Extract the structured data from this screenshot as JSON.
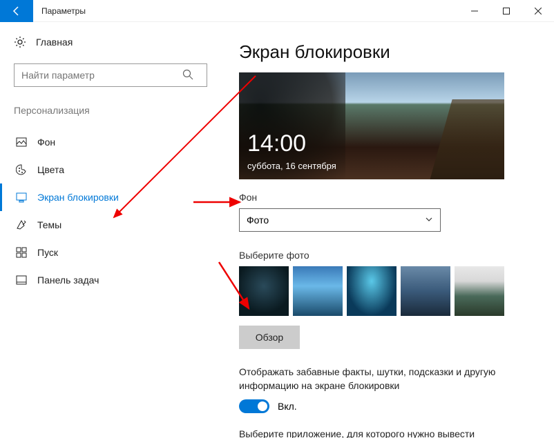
{
  "window": {
    "title": "Параметры"
  },
  "sidebar": {
    "home": "Главная",
    "search_placeholder": "Найти параметр",
    "category": "Персонализация",
    "items": [
      {
        "label": "Фон"
      },
      {
        "label": "Цвета"
      },
      {
        "label": "Экран блокировки"
      },
      {
        "label": "Темы"
      },
      {
        "label": "Пуск"
      },
      {
        "label": "Панель задач"
      }
    ]
  },
  "main": {
    "title": "Экран блокировки",
    "preview": {
      "time": "14:00",
      "date": "суббота, 16 сентября"
    },
    "background_label": "Фон",
    "background_value": "Фото",
    "choose_photo_label": "Выберите фото",
    "browse_button": "Обзор",
    "tips_text": "Отображать забавные факты, шутки, подсказки и другую информацию на экране блокировки",
    "toggle_label": "Вкл.",
    "app_text": "Выберите приложение, для которого нужно вывести"
  }
}
